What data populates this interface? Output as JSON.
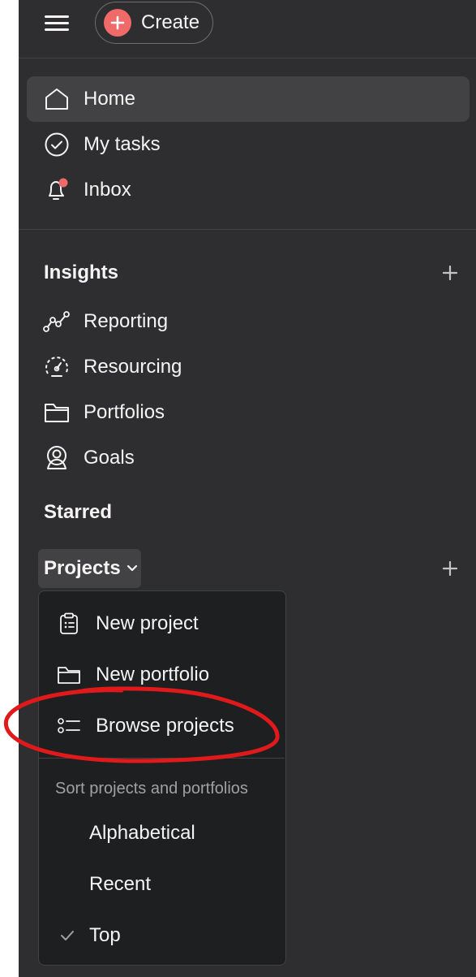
{
  "topbar": {
    "menu_icon": "hamburger-icon",
    "create_label": "Create",
    "create_icon": "plus-circle-icon"
  },
  "nav": {
    "items": [
      {
        "label": "Home",
        "icon": "home-icon",
        "active": true
      },
      {
        "label": "My tasks",
        "icon": "check-circle-icon",
        "active": false
      },
      {
        "label": "Inbox",
        "icon": "bell-icon",
        "active": false,
        "has_notification_dot": true
      }
    ]
  },
  "insights": {
    "title": "Insights",
    "items": [
      {
        "label": "Reporting",
        "icon": "line-chart-icon"
      },
      {
        "label": "Resourcing",
        "icon": "gauge-icon"
      },
      {
        "label": "Portfolios",
        "icon": "folder-icon"
      },
      {
        "label": "Goals",
        "icon": "goal-person-icon"
      }
    ]
  },
  "starred": {
    "title": "Starred"
  },
  "projects": {
    "label": "Projects",
    "menu": {
      "items": [
        {
          "label": "New project",
          "icon": "clipboard-icon"
        },
        {
          "label": "New portfolio",
          "icon": "folder-icon"
        },
        {
          "label": "Browse projects",
          "icon": "list-icon"
        }
      ],
      "sort_heading": "Sort projects and portfolios",
      "sort_options": [
        {
          "label": "Alphabetical",
          "selected": false
        },
        {
          "label": "Recent",
          "selected": false
        },
        {
          "label": "Top",
          "selected": true
        }
      ]
    }
  },
  "colors": {
    "sidebar_bg": "#2e2e30",
    "menu_bg": "#1e1f21",
    "accent": "#f06a6a",
    "annotation": "#e0191b"
  }
}
